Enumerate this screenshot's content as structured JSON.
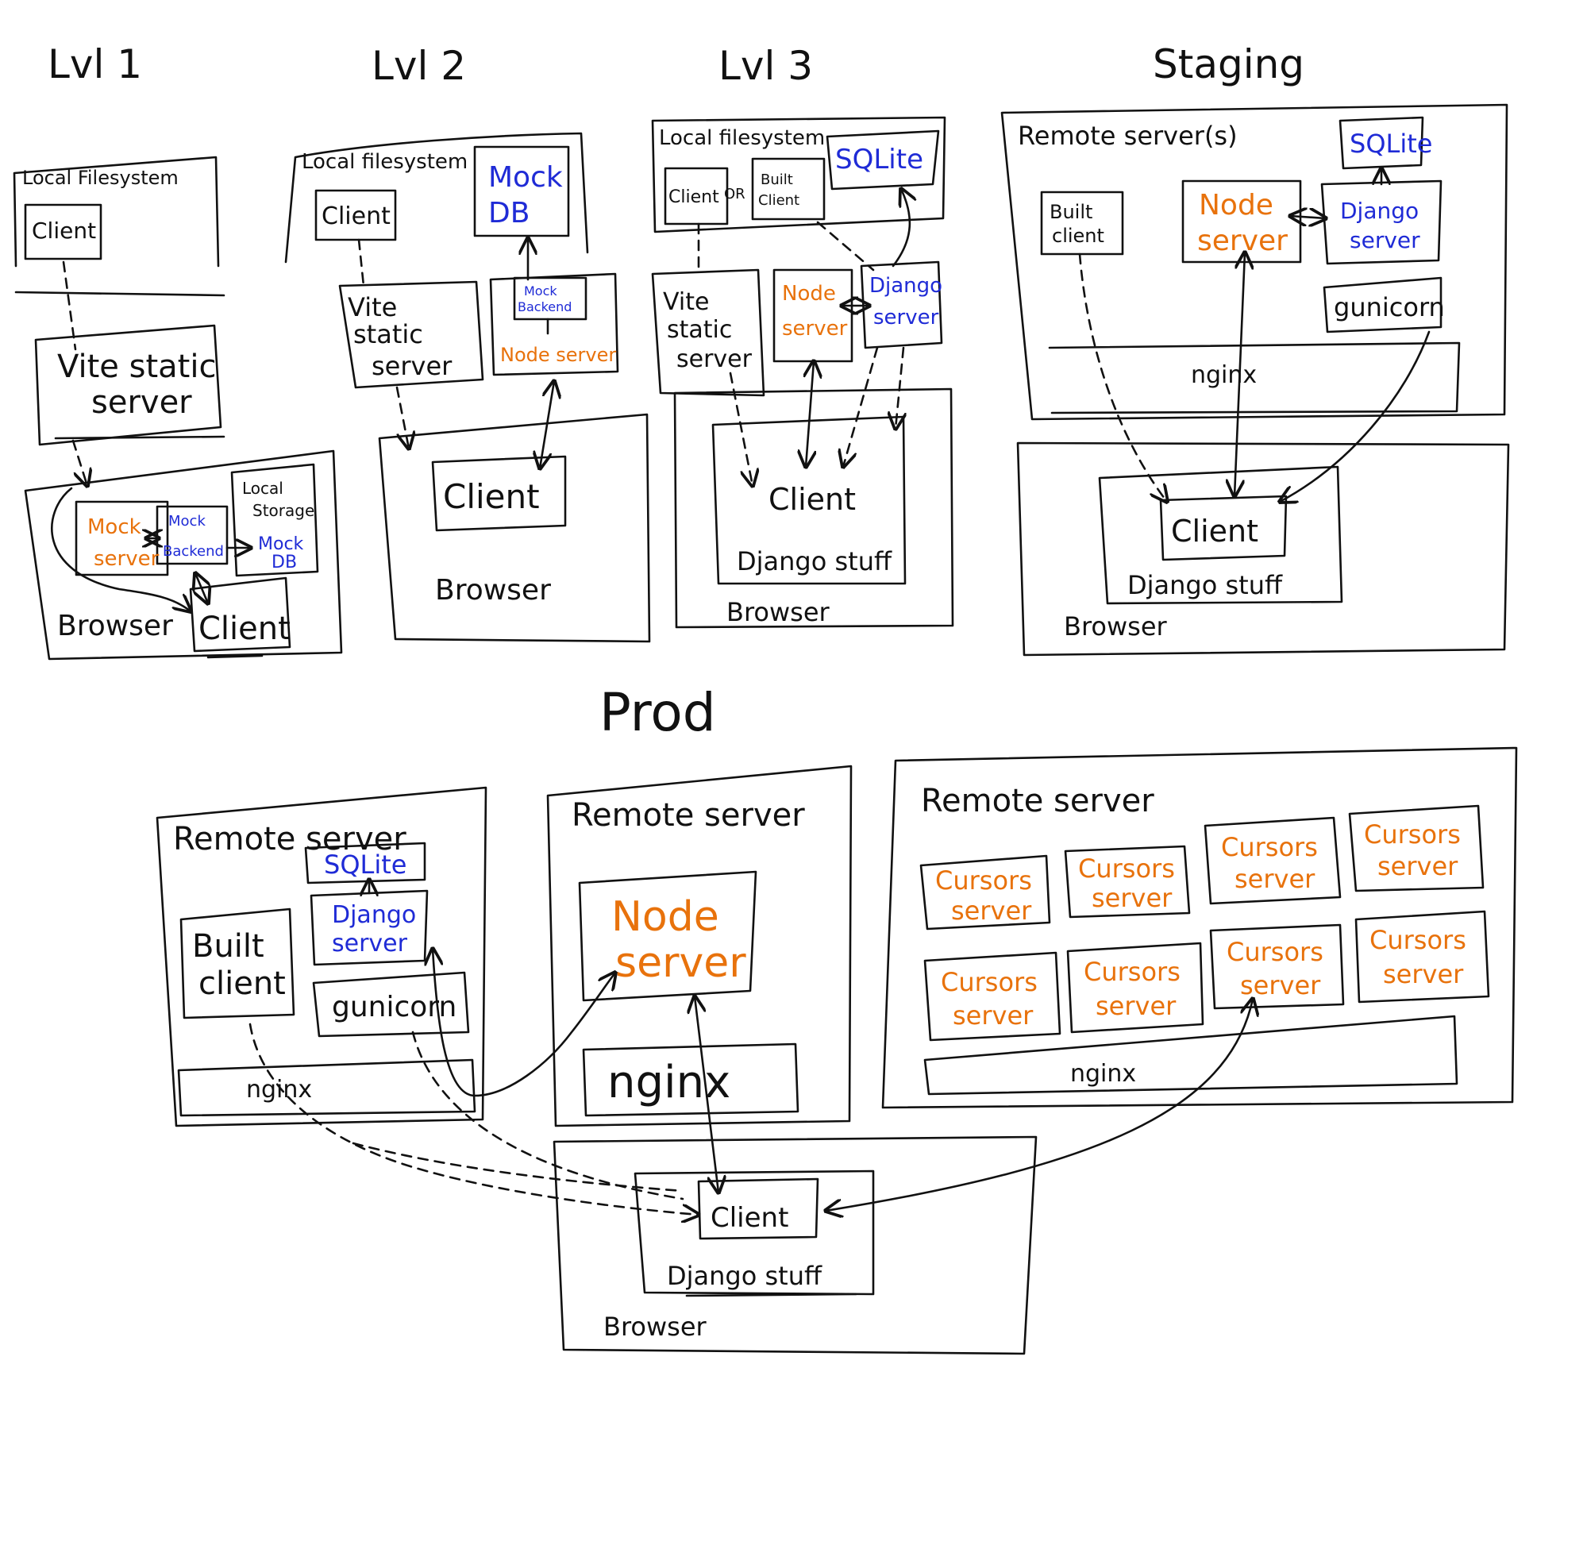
{
  "colors": {
    "ink": "#111111",
    "blue": "#1f2bd6",
    "orange": "#e8720c"
  },
  "lvl1": {
    "title": "Lvl 1",
    "local_filesystem": "Local Filesystem",
    "client": "Client",
    "vite_line1": "Vite static",
    "vite_line2": "server",
    "mock_line1": "Mock",
    "mock_line2": "server",
    "mock_backend_line1": "Mock",
    "mock_backend_line2": "Backend",
    "local_storage_line1": "Local",
    "local_storage_line2": "Storage",
    "mock_db_line1": "Mock",
    "mock_db_line2": "DB",
    "browser": "Browser",
    "browser_client": "Client"
  },
  "lvl2": {
    "title": "Lvl 2",
    "local_filesystem": "Local filesystem",
    "client": "Client",
    "mock_db_line1": "Mock",
    "mock_db_line2": "DB",
    "vite_line1": "Vite",
    "vite_line2": "static",
    "vite_line3": "server",
    "mock_backend_line1": "Mock",
    "mock_backend_line2": "Backend",
    "node_server": "Node server",
    "browser_client": "Client",
    "browser": "Browser"
  },
  "lvl3": {
    "title": "Lvl 3",
    "local_filesystem": "Local filesystem",
    "client": "Client",
    "or": "OR",
    "built_line1": "Built",
    "built_line2": "Client",
    "sqlite": "SQLite",
    "vite_line1": "Vite",
    "vite_line2": "static",
    "vite_line3": "server",
    "node_line1": "Node",
    "node_line2": "server",
    "django_line1": "Django",
    "django_line2": "server",
    "browser_client": "Client",
    "django_stuff": "Django stuff",
    "browser": "Browser"
  },
  "staging": {
    "title": "Staging",
    "remote_servers": "Remote server(s)",
    "built_line1": "Built",
    "built_line2": "client",
    "node_line1": "Node",
    "node_line2": "server",
    "sqlite": "SQLite",
    "django_line1": "Django",
    "django_line2": "server",
    "gunicorn": "gunicorn",
    "nginx": "nginx",
    "browser_client": "Client",
    "django_stuff": "Django stuff",
    "browser": "Browser"
  },
  "prod": {
    "title": "Prod",
    "remote1": {
      "label": "Remote server",
      "sqlite": "SQLite",
      "django_line1": "Django",
      "django_line2": "server",
      "built_line1": "Built",
      "built_line2": "client",
      "gunicorn": "gunicorn",
      "nginx": "nginx"
    },
    "remote2": {
      "label": "Remote server",
      "node_line1": "Node",
      "node_line2": "server",
      "nginx": "nginx"
    },
    "remote3": {
      "label": "Remote server",
      "cursors_line1": "Cursors",
      "cursors_line2": "server",
      "nginx": "nginx"
    },
    "browser_client": "Client",
    "django_stuff": "Django stuff",
    "browser": "Browser"
  }
}
